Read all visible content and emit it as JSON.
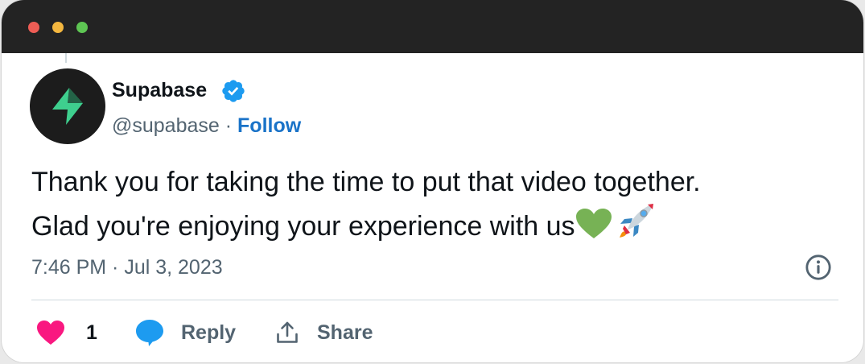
{
  "window": {
    "title_dots": [
      "close",
      "minimize",
      "maximize"
    ],
    "dot_colors": {
      "close": "#ee5d55",
      "minimize": "#f4b73f",
      "maximize": "#5ec553"
    }
  },
  "tweet": {
    "author": {
      "name": "Supabase",
      "handle": "@supabase",
      "separator": " · ",
      "follow_label": "Follow",
      "verified": true,
      "avatar_icon": "supabase-logo-icon"
    },
    "text_line1": "Thank you for taking the time to put that video together.",
    "text_line2": "Glad you're enjoying your experience with us",
    "text_emojis": [
      "green-heart",
      "rocket"
    ],
    "timestamp": "7:46 PM · Jul 3, 2023",
    "actions": {
      "like_count": "1",
      "reply_label": "Reply",
      "share_label": "Share"
    }
  },
  "colors": {
    "accent_blue": "#1a73c8",
    "verified_blue": "#1d9bf0",
    "like_pink": "#f91880",
    "text_primary": "#0f1419",
    "text_secondary": "#536471",
    "brand_green": "#3ecf8e"
  }
}
